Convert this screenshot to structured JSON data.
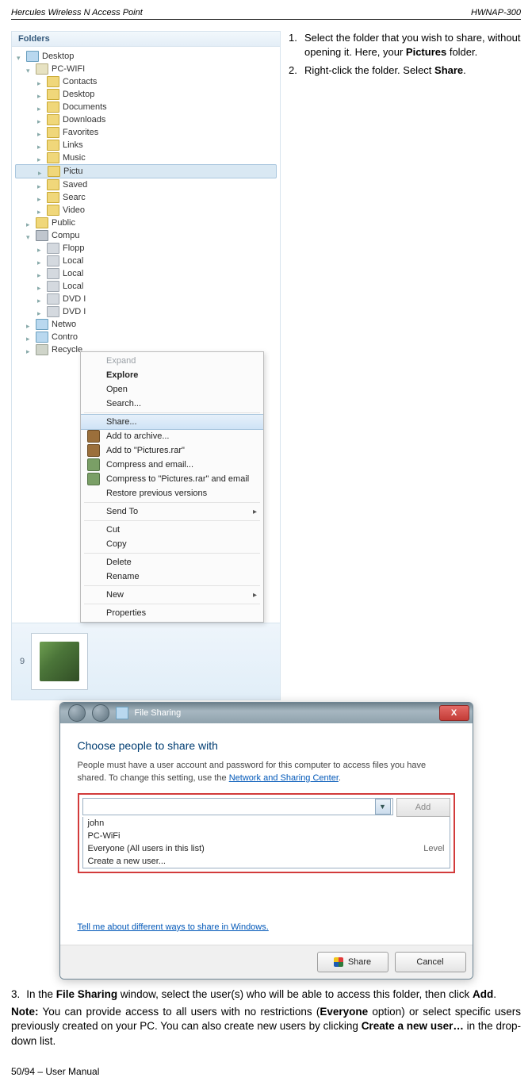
{
  "header": {
    "left": "Hercules Wireless N Access Point",
    "right": "HWNAP-300"
  },
  "folders": {
    "title": "Folders",
    "tree": [
      {
        "label": "Desktop",
        "icon": "desktop",
        "indent": 0,
        "tri": "open"
      },
      {
        "label": "PC-WIFI",
        "icon": "user",
        "indent": 1,
        "tri": "open"
      },
      {
        "label": "Contacts",
        "icon": "folder",
        "indent": 2,
        "tri": "closed"
      },
      {
        "label": "Desktop",
        "icon": "folder",
        "indent": 2,
        "tri": "closed"
      },
      {
        "label": "Documents",
        "icon": "folder",
        "indent": 2,
        "tri": "closed"
      },
      {
        "label": "Downloads",
        "icon": "folder",
        "indent": 2,
        "tri": "closed"
      },
      {
        "label": "Favorites",
        "icon": "folder",
        "indent": 2,
        "tri": "closed"
      },
      {
        "label": "Links",
        "icon": "folder",
        "indent": 2,
        "tri": "closed"
      },
      {
        "label": "Music",
        "icon": "folder",
        "indent": 2,
        "tri": "closed"
      },
      {
        "label": "Pictu",
        "icon": "folder",
        "indent": 2,
        "tri": "closed",
        "selected": true
      },
      {
        "label": "Saved",
        "icon": "folder",
        "indent": 2,
        "tri": "closed"
      },
      {
        "label": "Searc",
        "icon": "folder",
        "indent": 2,
        "tri": "closed"
      },
      {
        "label": "Video",
        "icon": "folder",
        "indent": 2,
        "tri": "closed"
      },
      {
        "label": "Public",
        "icon": "folder",
        "indent": 1,
        "tri": "closed"
      },
      {
        "label": "Compu",
        "icon": "comp",
        "indent": 1,
        "tri": "open"
      },
      {
        "label": "Flopp",
        "icon": "drv",
        "indent": 2,
        "tri": "closed"
      },
      {
        "label": "Local",
        "icon": "drv",
        "indent": 2,
        "tri": "closed"
      },
      {
        "label": "Local",
        "icon": "drv",
        "indent": 2,
        "tri": "closed"
      },
      {
        "label": "Local",
        "icon": "drv",
        "indent": 2,
        "tri": "closed"
      },
      {
        "label": "DVD I",
        "icon": "drv",
        "indent": 2,
        "tri": "closed"
      },
      {
        "label": "DVD I",
        "icon": "drv",
        "indent": 2,
        "tri": "closed"
      },
      {
        "label": "Netwo",
        "icon": "net",
        "indent": 1,
        "tri": "closed"
      },
      {
        "label": "Contro",
        "icon": "ctrl",
        "indent": 1,
        "tri": "closed"
      },
      {
        "label": "Recycle",
        "icon": "bin",
        "indent": 1,
        "tri": "closed"
      }
    ],
    "preview_count": "9"
  },
  "context_menu": [
    {
      "label": "Expand",
      "kind": "plain",
      "dim": true
    },
    {
      "label": "Explore",
      "kind": "bold"
    },
    {
      "label": "Open",
      "kind": "plain"
    },
    {
      "label": "Search...",
      "kind": "plain"
    },
    {
      "sep": true
    },
    {
      "label": "Share...",
      "kind": "plain",
      "hover": true
    },
    {
      "label": "Add to archive...",
      "kind": "plain",
      "ico": "box"
    },
    {
      "label": "Add to \"Pictures.rar\"",
      "kind": "plain",
      "ico": "box"
    },
    {
      "label": "Compress and email...",
      "kind": "plain",
      "ico": "boxg"
    },
    {
      "label": "Compress to \"Pictures.rar\" and email",
      "kind": "plain",
      "ico": "boxg"
    },
    {
      "label": "Restore previous versions",
      "kind": "plain"
    },
    {
      "sep": true
    },
    {
      "label": "Send To",
      "kind": "plain",
      "arrow": true
    },
    {
      "sep": true
    },
    {
      "label": "Cut",
      "kind": "plain"
    },
    {
      "label": "Copy",
      "kind": "plain"
    },
    {
      "sep": true
    },
    {
      "label": "Delete",
      "kind": "plain"
    },
    {
      "label": "Rename",
      "kind": "plain"
    },
    {
      "sep": true
    },
    {
      "label": "New",
      "kind": "plain",
      "arrow": true
    },
    {
      "sep": true
    },
    {
      "label": "Properties",
      "kind": "plain"
    }
  ],
  "steps": {
    "s1_num": "1.",
    "s1_a": "Select the folder that you wish to share, without",
    "s1_b": "opening it.  Here, your ",
    "s1_bold": "Pictures",
    "s1_c": " folder.",
    "s2_num": "2.",
    "s2_a": "Right-click the folder.  Select ",
    "s2_bold": "Share",
    "s2_b": "."
  },
  "dialog": {
    "title": "File Sharing",
    "heading": "Choose people to share with",
    "body_a": "People must have a user account and password for this computer to access files you have shared.  To change this setting, use the ",
    "body_link": "Network and Sharing Center",
    "body_b": ".",
    "add": "Add",
    "options": [
      {
        "label": "john"
      },
      {
        "label": "PC-WiFi"
      },
      {
        "label": "Everyone (All users in this list)",
        "level": "Level"
      },
      {
        "label": "Create a new user..."
      }
    ],
    "footer_link": "Tell me about different ways to share in Windows.",
    "btn_share": "Share",
    "btn_cancel": "Cancel",
    "close_x": "X"
  },
  "below": {
    "s3_num": "3.",
    "s3_a": "In the ",
    "s3_b1": "File Sharing",
    "s3_b": " window, select the user(s) who will be able to access this folder, then click ",
    "s3_b2": "Add",
    "s3_c": ".",
    "note_bold": "Note:",
    "note_a": " You can provide access to all users with no restrictions (",
    "note_b1": "Everyone",
    "note_b": " option) or select specific users previously created on your PC.  You can also create new users by clicking ",
    "note_b2": "Create a new user…",
    "note_c": " in the drop-down list."
  },
  "footer": "50/94 – User Manual"
}
